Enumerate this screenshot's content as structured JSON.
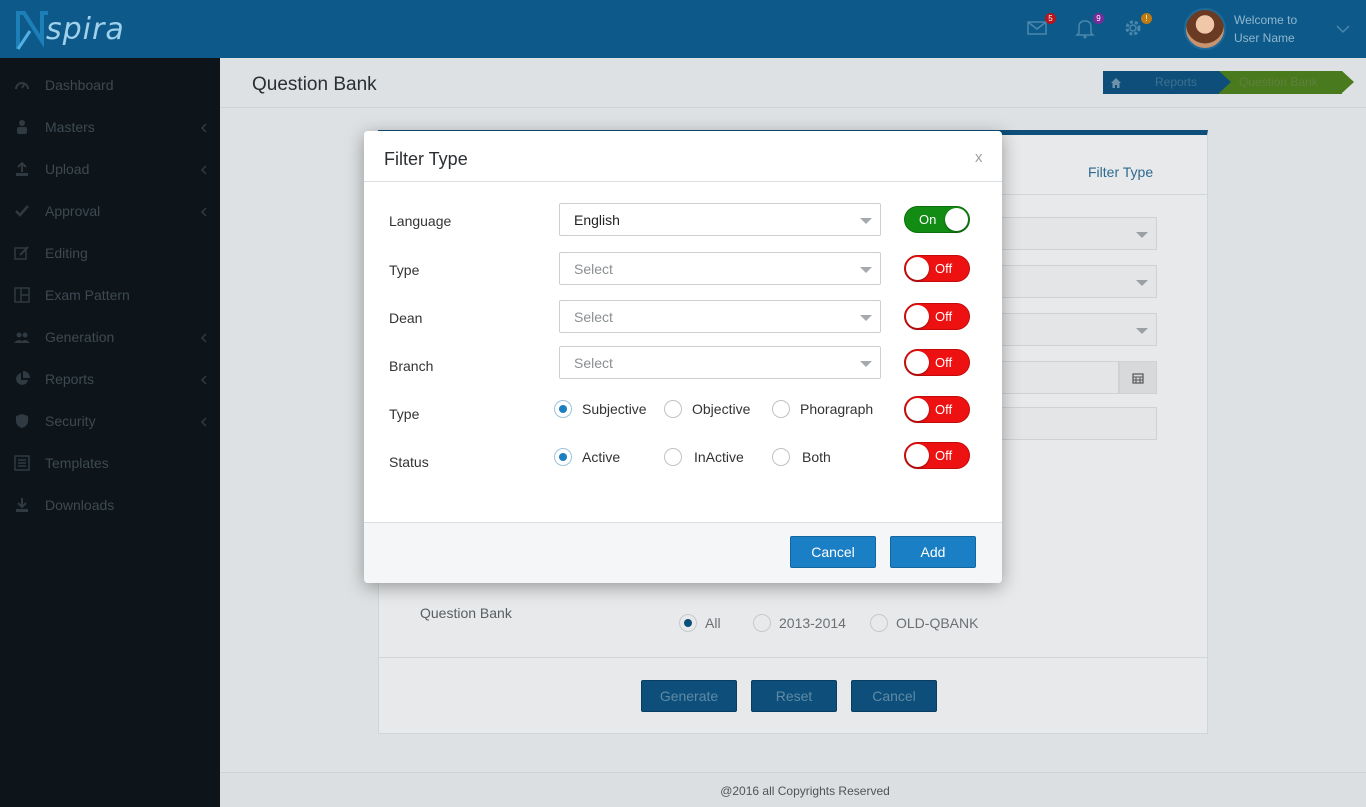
{
  "header": {
    "logo_text": "spira",
    "mail_count": "5",
    "notif_count": "9",
    "settings_count": "!",
    "welcome": "Welcome to",
    "user_name": "User Name"
  },
  "sidebar": {
    "items": [
      {
        "label": "Dashboard",
        "icon": "dashboard-icon"
      },
      {
        "label": "Masters",
        "icon": "masters-icon"
      },
      {
        "label": "Upload",
        "icon": "upload-icon"
      },
      {
        "label": "Approval",
        "icon": "check-icon"
      },
      {
        "label": "Editing",
        "icon": "edit-icon"
      },
      {
        "label": "Exam Pattern",
        "icon": "grid-icon"
      },
      {
        "label": "Generation",
        "icon": "users-icon"
      },
      {
        "label": "Reports",
        "icon": "pie-icon"
      },
      {
        "label": "Security",
        "icon": "shield-icon"
      },
      {
        "label": "Templates",
        "icon": "template-icon"
      },
      {
        "label": "Downloads",
        "icon": "download-icon"
      }
    ]
  },
  "page": {
    "title": "Question Bank",
    "breadcrumb": [
      "Reports",
      "Question Bank"
    ],
    "panel_tab": "Filter Type",
    "qbank_label": "Question Bank",
    "qbank_options": [
      "All",
      "2013-2014",
      "OLD-QBANK"
    ],
    "buttons": [
      "Generate",
      "Reset",
      "Cancel"
    ]
  },
  "footer": {
    "text": "@2016 all Copyrights Reserved"
  },
  "modal": {
    "title": "Filter Type",
    "close": "x",
    "rows": [
      {
        "label": "Language",
        "value": "English",
        "toggle": "On"
      },
      {
        "label": "Type",
        "placeholder": "Select",
        "toggle": "Off"
      },
      {
        "label": "Dean",
        "placeholder": "Select",
        "toggle": "Off"
      },
      {
        "label": "Branch",
        "placeholder": "Select",
        "toggle": "Off"
      }
    ],
    "type_row": {
      "label": "Type",
      "options": [
        "Subjective",
        "Objective",
        "Phoragraph"
      ],
      "selected": "Subjective",
      "toggle": "Off"
    },
    "status_row": {
      "label": "Status",
      "options": [
        "Active",
        "InActive",
        "Both"
      ],
      "selected": "Active",
      "toggle": "Off"
    },
    "cancel_label": "Cancel",
    "add_label": "Add"
  },
  "colors": {
    "header_bg": "#0d5a8a",
    "sidebar_bg": "#0d141a",
    "toggle_on": "#128c12",
    "toggle_off": "#ee1111",
    "button_primary": "#1a7fc4"
  }
}
